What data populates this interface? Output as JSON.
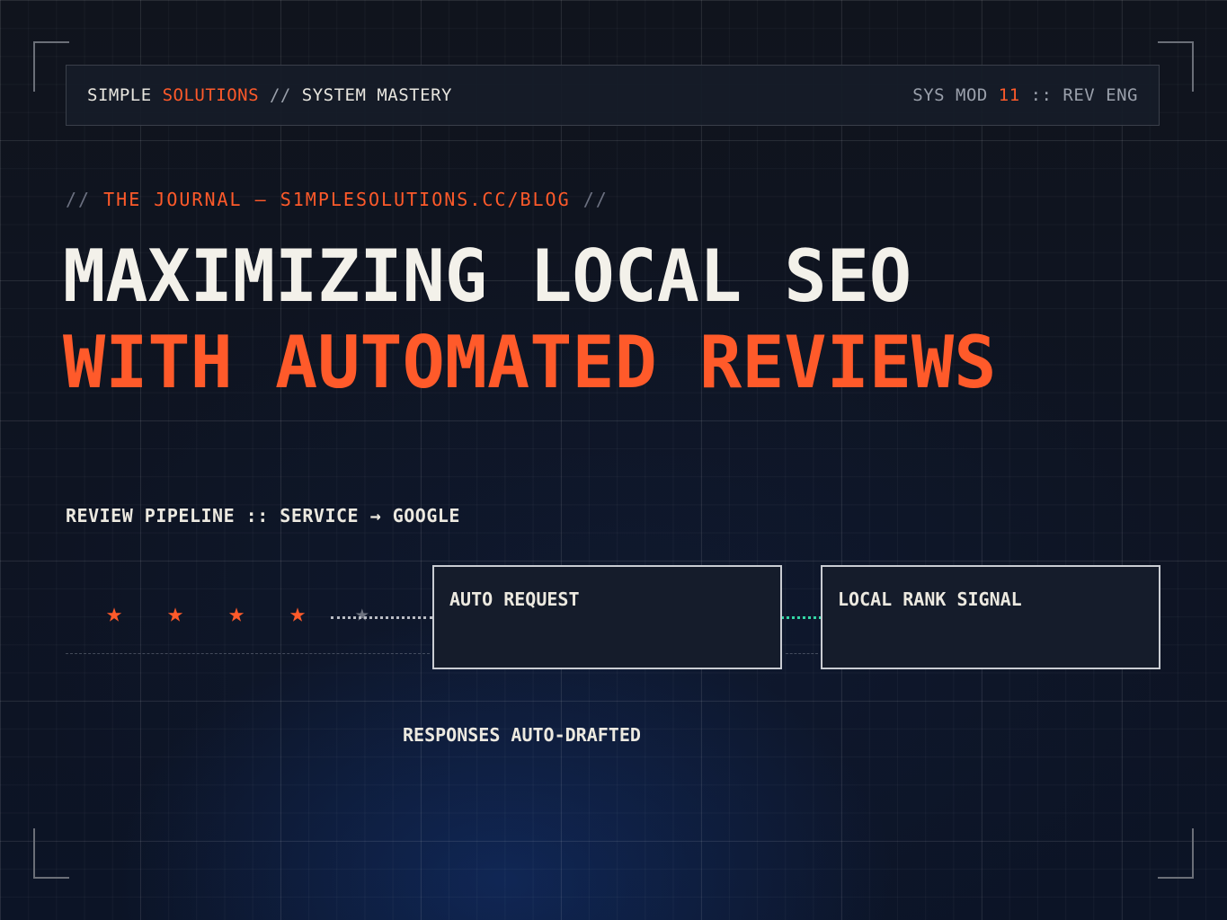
{
  "header": {
    "brand_a": "SIMPLE ",
    "brand_b": "SOLUTIONS",
    "brand_sep": " // ",
    "brand_c": "SYSTEM MASTERY",
    "sys_a": "SYS MOD ",
    "sys_num": "11",
    "sys_sep": " :: ",
    "sys_b": "REV ENG"
  },
  "kicker": {
    "slash_left": "// ",
    "text": "THE JOURNAL — S1MPLESOLUTIONS.CC/BLOG",
    "slash_right": " //"
  },
  "title": {
    "line1": "MAXIMIZING LOCAL SEO",
    "line2": "WITH AUTOMATED REVIEWS"
  },
  "pipeline": {
    "label": "REVIEW PIPELINE :: SERVICE → GOOGLE",
    "star_glyph": "★",
    "rating_filled": 4,
    "rating_total": 5,
    "nodes": [
      {
        "label": "AUTO REQUEST"
      },
      {
        "label": "LOCAL RANK SIGNAL"
      }
    ],
    "note": "RESPONSES AUTO-DRAFTED"
  },
  "colors": {
    "accent": "#ff5a2a",
    "teal": "#33d6a6",
    "text": "#ece9e0",
    "background": "#0f1420"
  }
}
